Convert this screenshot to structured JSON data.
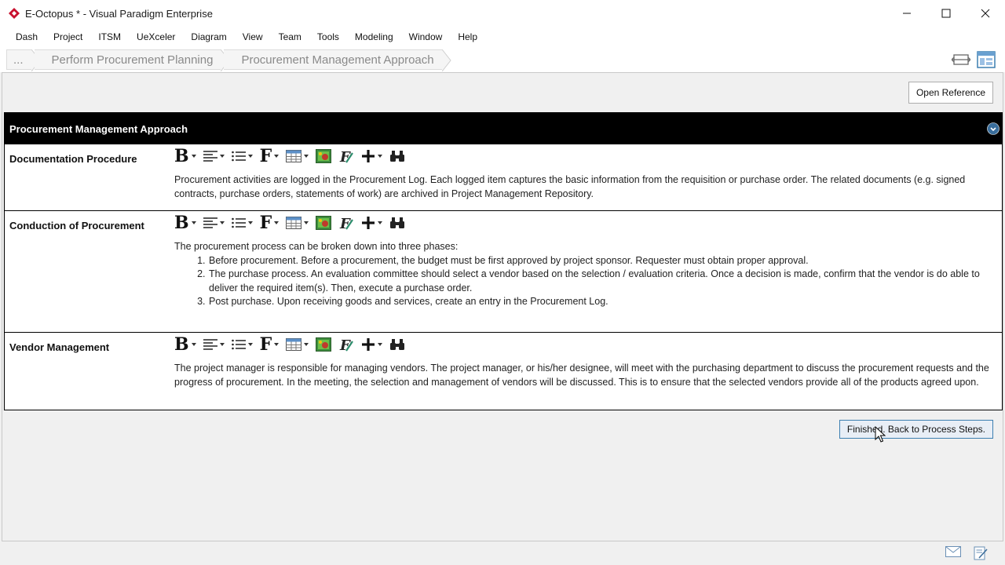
{
  "window": {
    "title": "E-Octopus * - Visual Paradigm Enterprise",
    "controls": [
      "minimize-icon",
      "maximize-icon",
      "close-icon"
    ]
  },
  "menu": [
    "Dash",
    "Project",
    "ITSM",
    "UeXceler",
    "Diagram",
    "View",
    "Team",
    "Tools",
    "Modeling",
    "Window",
    "Help"
  ],
  "breadcrumb": {
    "items": [
      "...",
      "Perform Procurement Planning",
      "Procurement Management Approach"
    ]
  },
  "actions": {
    "open_reference": "Open Reference",
    "finish": "Finished. Back to Process Steps."
  },
  "form": {
    "title": "Procurement Management Approach",
    "rows": [
      {
        "label": "Documentation Procedure",
        "text": "Procurement activities are logged in the Procurement Log. Each logged item captures the basic information from the requisition or purchase order. The related documents (e.g. signed contracts, purchase orders, statements of work) are archived in Project Management Repository."
      },
      {
        "label": "Conduction of Procurement",
        "intro": "The procurement process can be broken down into three phases:",
        "list": [
          "Before procurement. Before a procurement, the budget must be first approved by project sponsor. Requester must obtain proper approval.",
          "The purchase process. An evaluation committee should select a vendor based on the selection / evaluation criteria. Once a decision is made, confirm that the vendor is do able to deliver the required item(s). Then, execute a purchase order.",
          "Post purchase. Upon receiving goods and services, create an entry in the Procurement Log."
        ]
      },
      {
        "label": "Vendor Management",
        "text": "The project manager is responsible for managing vendors. The project manager, or his/her designee, will meet with the purchasing department to discuss the procurement requests and the progress of procurement. In the meeting, the selection and management of vendors will be discussed. This is to ensure that the selected vendors provide all of the products agreed upon."
      }
    ]
  },
  "toolbar_icons": [
    "bold-icon",
    "align-icon",
    "list-icon",
    "font-icon",
    "table-icon",
    "image-icon",
    "formula-icon",
    "insert-icon",
    "find-icon"
  ],
  "colors": {
    "header_bg": "#000000",
    "accent": "#3c7fb1",
    "logo_red": "#c8102e"
  }
}
